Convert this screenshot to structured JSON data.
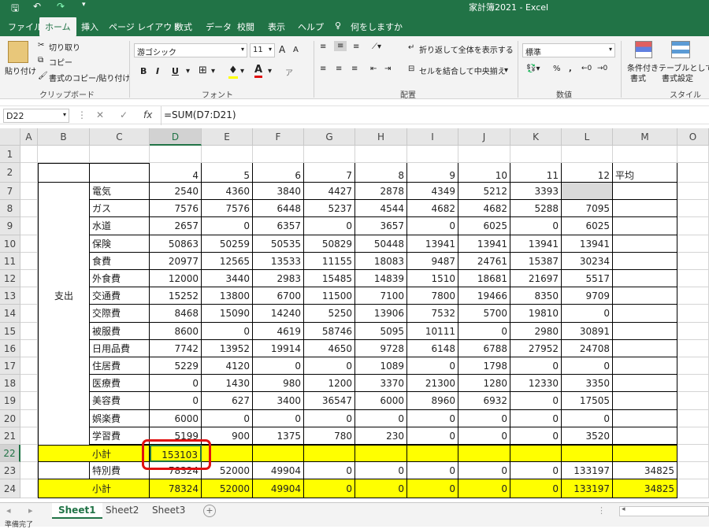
{
  "window": {
    "title": "家計簿2021 - Excel"
  },
  "ribbon_tabs": [
    "ファイル",
    "ホーム",
    "挿入",
    "ページ レイアウト",
    "数式",
    "データ",
    "校閲",
    "表示",
    "ヘルプ"
  ],
  "tell_me": "何をしますか",
  "clipboard": {
    "paste": "貼り付け",
    "cut": "切り取り",
    "copy": "コピー",
    "format_painter": "書式のコピー/貼り付け",
    "label": "クリップボード"
  },
  "font": {
    "name": "游ゴシック",
    "size": "11",
    "label": "フォント",
    "bold": "B",
    "italic": "I",
    "underline": "U",
    "grow": "A",
    "shrink": "A"
  },
  "alignment": {
    "wrap": "折り返して全体を表示する",
    "merge": "セルを結合して中央揃え",
    "label": "配置"
  },
  "number": {
    "format": "標準",
    "label": "数値",
    "percent": "%"
  },
  "styles": {
    "conditional": "条件付き",
    "conditional2": "書式",
    "table": "テーブルとして",
    "table2": "書式設定",
    "label": "スタイル"
  },
  "formula_bar": {
    "name_box": "D22",
    "fx": "fx",
    "formula": "=SUM(D7:D21)"
  },
  "columns": [
    "A",
    "B",
    "C",
    "D",
    "E",
    "F",
    "G",
    "H",
    "I",
    "J",
    "K",
    "L",
    "M",
    "O"
  ],
  "row_numbers": [
    "1",
    "2",
    "7",
    "8",
    "9",
    "10",
    "11",
    "12",
    "13",
    "14",
    "15",
    "16",
    "17",
    "18",
    "19",
    "20",
    "21",
    "22",
    "23",
    "24"
  ],
  "header_row": {
    "months": [
      "4",
      "5",
      "6",
      "7",
      "8",
      "9",
      "10",
      "11",
      "12"
    ],
    "avg": "平均"
  },
  "group_label": "支出",
  "expense_rows": [
    {
      "row": "7",
      "label": "電気",
      "values": [
        "2540",
        "4360",
        "3840",
        "4427",
        "2878",
        "4349",
        "5212",
        "3393",
        ""
      ]
    },
    {
      "row": "8",
      "label": "ガス",
      "values": [
        "7576",
        "7576",
        "6448",
        "5237",
        "4544",
        "4682",
        "4682",
        "5288",
        "7095"
      ]
    },
    {
      "row": "9",
      "label": "水道",
      "values": [
        "2657",
        "0",
        "6357",
        "0",
        "3657",
        "0",
        "6025",
        "0",
        "6025"
      ]
    },
    {
      "row": "10",
      "label": "保険",
      "values": [
        "50863",
        "50259",
        "50535",
        "50829",
        "50448",
        "13941",
        "13941",
        "13941",
        "13941"
      ]
    },
    {
      "row": "11",
      "label": "食費",
      "values": [
        "20977",
        "12565",
        "13533",
        "11155",
        "18083",
        "9487",
        "24761",
        "15387",
        "30234"
      ]
    },
    {
      "row": "12",
      "label": "外食費",
      "values": [
        "12000",
        "3440",
        "2983",
        "15485",
        "14839",
        "1510",
        "18681",
        "21697",
        "5517"
      ]
    },
    {
      "row": "13",
      "label": "交通費",
      "values": [
        "15252",
        "13800",
        "6700",
        "11500",
        "7100",
        "7800",
        "19466",
        "8350",
        "9709"
      ]
    },
    {
      "row": "14",
      "label": "交際費",
      "values": [
        "8468",
        "15090",
        "14240",
        "5250",
        "13906",
        "7532",
        "5700",
        "19810",
        "0"
      ]
    },
    {
      "row": "15",
      "label": "被服費",
      "values": [
        "8600",
        "0",
        "4619",
        "58746",
        "5095",
        "10111",
        "0",
        "2980",
        "30891"
      ]
    },
    {
      "row": "16",
      "label": "日用品費",
      "values": [
        "7742",
        "13952",
        "19914",
        "4650",
        "9728",
        "6148",
        "6788",
        "27952",
        "24708"
      ]
    },
    {
      "row": "17",
      "label": "住居費",
      "values": [
        "5229",
        "4120",
        "0",
        "0",
        "1089",
        "0",
        "1798",
        "0",
        "0"
      ]
    },
    {
      "row": "18",
      "label": "医療費",
      "values": [
        "0",
        "1430",
        "980",
        "1200",
        "3370",
        "21300",
        "1280",
        "12330",
        "3350"
      ]
    },
    {
      "row": "19",
      "label": "美容費",
      "values": [
        "0",
        "627",
        "3400",
        "36547",
        "6000",
        "8960",
        "6932",
        "0",
        "17505"
      ]
    },
    {
      "row": "20",
      "label": "娯楽費",
      "values": [
        "6000",
        "0",
        "0",
        "0",
        "0",
        "0",
        "0",
        "0",
        "0"
      ]
    },
    {
      "row": "21",
      "label": "学習費",
      "values": [
        "5199",
        "900",
        "1375",
        "780",
        "230",
        "0",
        "0",
        "0",
        "3520"
      ]
    }
  ],
  "subtotal1": {
    "label": "小計",
    "value": "153103"
  },
  "special_row": {
    "label": "特別費",
    "values": [
      "78324",
      "52000",
      "49904",
      "0",
      "0",
      "0",
      "0",
      "0",
      "133197",
      "34825"
    ]
  },
  "subtotal2": {
    "label": "小計",
    "values": [
      "78324",
      "52000",
      "49904",
      "0",
      "0",
      "0",
      "0",
      "0",
      "133197",
      "34825"
    ]
  },
  "sheets": [
    "Sheet1",
    "Sheet2",
    "Sheet3"
  ],
  "status": "準備完了",
  "colors": {
    "excel_green": "#217346",
    "highlight": "#ffff00",
    "annotation": "#e01010"
  }
}
